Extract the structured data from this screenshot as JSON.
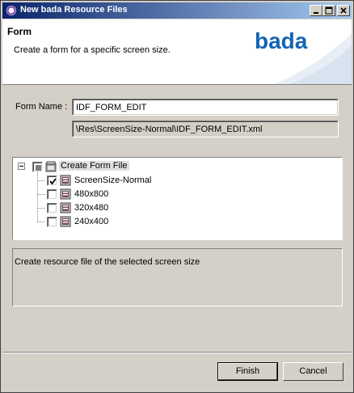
{
  "window": {
    "title": "New bada Resource Files"
  },
  "banner": {
    "title": "Form",
    "description": "Create a form for a specific screen size.",
    "logo_text": "bada"
  },
  "form": {
    "name_label": "Form Name :",
    "name_value": "IDF_FORM_EDIT",
    "path_value": "\\Res\\ScreenSize-Normal\\IDF_FORM_EDIT.xml"
  },
  "tree": {
    "root": {
      "label": "Create Form File",
      "expanded": true,
      "state": "partial"
    },
    "items": [
      {
        "label": "ScreenSize-Normal",
        "checked": true
      },
      {
        "label": "480x800",
        "checked": false
      },
      {
        "label": "320x480",
        "checked": false
      },
      {
        "label": "240x400",
        "checked": false
      }
    ]
  },
  "description": "Create resource file of the selected screen size",
  "buttons": {
    "finish": "Finish",
    "cancel": "Cancel"
  },
  "colors": {
    "titlebar_start": "#0a246a",
    "titlebar_end": "#a6caf0",
    "dialog_bg": "#d4d0c8",
    "logo_blue": "#1464b4"
  }
}
